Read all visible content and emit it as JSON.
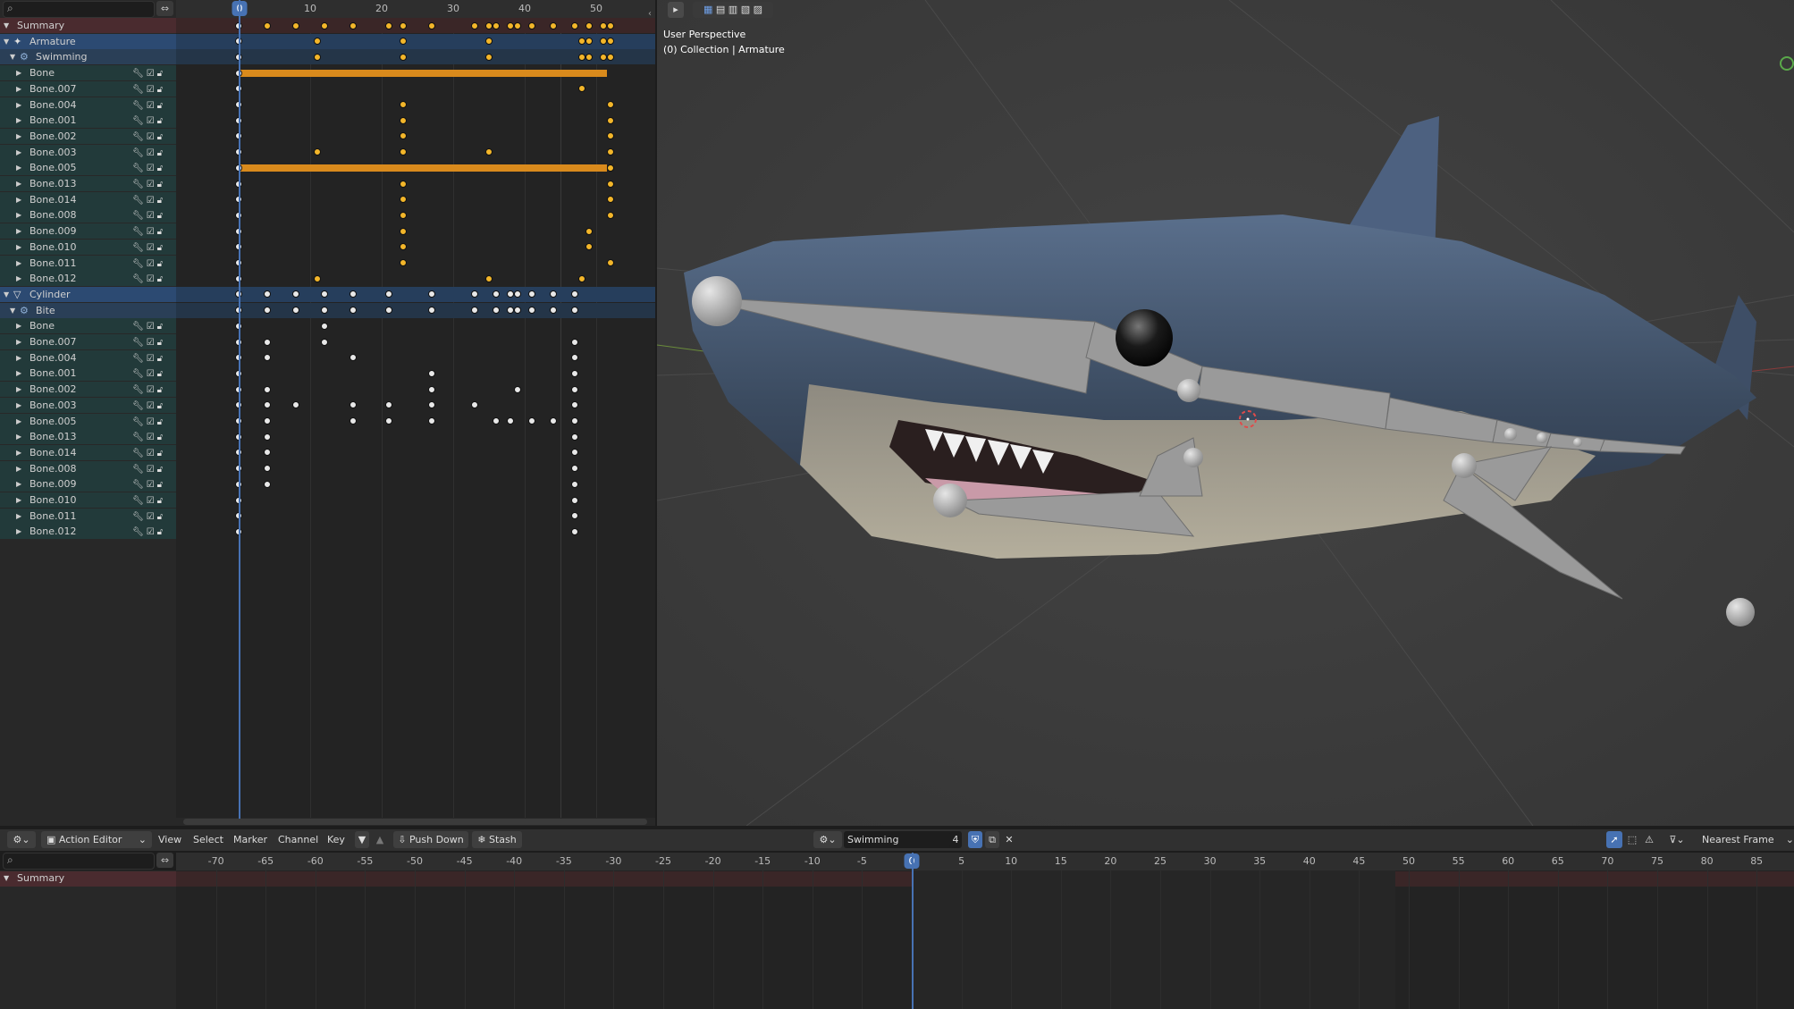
{
  "dopesheet": {
    "frame_ticks": [
      "10",
      "20",
      "30",
      "40",
      "50"
    ],
    "current_frame": "0",
    "channels": [
      {
        "name": "Summary",
        "type": "summary",
        "indent": 0,
        "expanded": true
      },
      {
        "name": "Armature",
        "type": "object",
        "indent": 0,
        "expanded": true
      },
      {
        "name": "Swimming",
        "type": "action",
        "indent": 1,
        "expanded": true
      },
      {
        "name": "Bone",
        "type": "bone",
        "indent": 2
      },
      {
        "name": "Bone.007",
        "type": "bone",
        "indent": 2
      },
      {
        "name": "Bone.004",
        "type": "bone",
        "indent": 2
      },
      {
        "name": "Bone.001",
        "type": "bone",
        "indent": 2
      },
      {
        "name": "Bone.002",
        "type": "bone",
        "indent": 2
      },
      {
        "name": "Bone.003",
        "type": "bone",
        "indent": 2
      },
      {
        "name": "Bone.005",
        "type": "bone",
        "indent": 2
      },
      {
        "name": "Bone.013",
        "type": "bone",
        "indent": 2
      },
      {
        "name": "Bone.014",
        "type": "bone",
        "indent": 2
      },
      {
        "name": "Bone.008",
        "type": "bone",
        "indent": 2
      },
      {
        "name": "Bone.009",
        "type": "bone",
        "indent": 2
      },
      {
        "name": "Bone.010",
        "type": "bone",
        "indent": 2
      },
      {
        "name": "Bone.011",
        "type": "bone",
        "indent": 2
      },
      {
        "name": "Bone.012",
        "type": "bone",
        "indent": 2
      },
      {
        "name": "Cylinder",
        "type": "object",
        "indent": 0,
        "expanded": true
      },
      {
        "name": "Bite",
        "type": "action",
        "indent": 1,
        "expanded": true
      },
      {
        "name": "Bone",
        "type": "bone",
        "indent": 2
      },
      {
        "name": "Bone.007",
        "type": "bone",
        "indent": 2
      },
      {
        "name": "Bone.004",
        "type": "bone",
        "indent": 2
      },
      {
        "name": "Bone.001",
        "type": "bone",
        "indent": 2
      },
      {
        "name": "Bone.002",
        "type": "bone",
        "indent": 2
      },
      {
        "name": "Bone.003",
        "type": "bone",
        "indent": 2
      },
      {
        "name": "Bone.005",
        "type": "bone",
        "indent": 2
      },
      {
        "name": "Bone.013",
        "type": "bone",
        "indent": 2
      },
      {
        "name": "Bone.014",
        "type": "bone",
        "indent": 2
      },
      {
        "name": "Bone.008",
        "type": "bone",
        "indent": 2
      },
      {
        "name": "Bone.009",
        "type": "bone",
        "indent": 2
      },
      {
        "name": "Bone.010",
        "type": "bone",
        "indent": 2
      },
      {
        "name": "Bone.011",
        "type": "bone",
        "indent": 2
      },
      {
        "name": "Bone.012",
        "type": "bone",
        "indent": 2
      }
    ]
  },
  "viewport": {
    "view_name": "User Perspective",
    "collection_info": "(0) Collection | Armature"
  },
  "action_editor": {
    "mode": "Action Editor",
    "menus": [
      "View",
      "Select",
      "Marker",
      "Channel",
      "Key"
    ],
    "push_down": "Push Down",
    "stash": "Stash",
    "action_name": "Swimming",
    "users": "4",
    "snapping": "Nearest Frame",
    "summary": "Summary",
    "frame_ticks": [
      "-70",
      "-65",
      "-60",
      "-55",
      "-50",
      "-45",
      "-40",
      "-35",
      "-30",
      "-25",
      "-20",
      "-15",
      "-10",
      "-5",
      "0",
      "5",
      "10",
      "15",
      "20",
      "25",
      "30",
      "35",
      "40",
      "45",
      "50",
      "55",
      "60",
      "65",
      "70",
      "75",
      "80",
      "85"
    ],
    "current_frame": "0"
  },
  "colors": {
    "accent": "#4772b3",
    "key_selected": "#f3b62a",
    "key_unselected": "#e8e8e8",
    "hold_bar": "#d98a1c"
  }
}
